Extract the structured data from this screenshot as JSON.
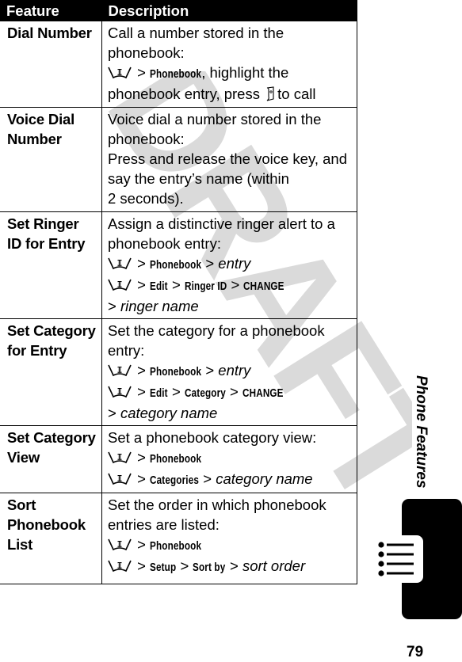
{
  "watermark": "DRAFT",
  "table": {
    "headers": [
      "Feature",
      "Description"
    ],
    "rows": [
      {
        "feature": "Dial Number",
        "desc": [
          {
            "text": "Call a number stored in the"
          },
          {
            "text": "phonebook:"
          },
          {
            "menu": true,
            "sep": ">",
            "cmd": "Phonebook",
            "tail": ", highlight the"
          },
          {
            "text": "phonebook entry, press",
            "send_key": true,
            "after": "to call"
          }
        ]
      },
      {
        "feature": "Voice Dial Number",
        "desc": [
          {
            "text": "Voice dial a number stored in the"
          },
          {
            "text": "phonebook:"
          },
          {
            "text": "Press and release the voice key, and"
          },
          {
            "text": "say the entry’s name (within"
          },
          {
            "text": "2 seconds)."
          }
        ]
      },
      {
        "feature": "Set Ringer ID for Entry",
        "desc": [
          {
            "text": "Assign a distinctive ringer alert to a"
          },
          {
            "text": "phonebook entry:"
          },
          {
            "menu": true,
            "path": [
              {
                "cmd": "Phonebook"
              },
              {
                "it": "entry"
              }
            ]
          },
          {
            "menu": true,
            "path": [
              {
                "cmd": "Edit"
              },
              {
                "cmd": "Ringer ID"
              },
              {
                "cmd": "CHANGE"
              }
            ]
          },
          {
            "path": [
              {
                "it": "ringer name"
              }
            ]
          }
        ]
      },
      {
        "feature": "Set Category for Entry",
        "desc": [
          {
            "text": "Set the category for a phonebook"
          },
          {
            "text": "entry:"
          },
          {
            "menu": true,
            "path": [
              {
                "cmd": "Phonebook"
              },
              {
                "it": "entry"
              }
            ]
          },
          {
            "menu": true,
            "path": [
              {
                "cmd": "Edit"
              },
              {
                "cmd": "Category"
              },
              {
                "cmd": "CHANGE"
              }
            ]
          },
          {
            "path": [
              {
                "it": "category name"
              }
            ]
          }
        ]
      },
      {
        "feature": "Set Category View",
        "desc": [
          {
            "text": "Set a phonebook category view:"
          },
          {
            "menu": true,
            "path": [
              {
                "cmd": "Phonebook"
              }
            ]
          },
          {
            "menu": true,
            "path": [
              {
                "cmd": "Categories"
              },
              {
                "it": "category name"
              }
            ]
          }
        ]
      },
      {
        "feature": "Sort Phonebook List",
        "desc": [
          {
            "text": "Set the order in which phonebook"
          },
          {
            "text": "entries are listed:"
          },
          {
            "menu": true,
            "path": [
              {
                "cmd": "Phonebook"
              }
            ]
          },
          {
            "menu": true,
            "path": [
              {
                "cmd": "Setup"
              },
              {
                "cmd": "Sort by"
              },
              {
                "it": "sort order"
              }
            ]
          }
        ]
      }
    ]
  },
  "sidebar": {
    "section_title": "Phone Features",
    "tab_icon": "list-icon"
  },
  "page_number": "79",
  "icons": {
    "menu_key": "menu-key-icon",
    "send_key": "send-key-icon"
  },
  "colors": {
    "text": "#000000",
    "header_bg": "#000000",
    "header_text": "#ffffff",
    "watermark": "#d9d9d9"
  }
}
